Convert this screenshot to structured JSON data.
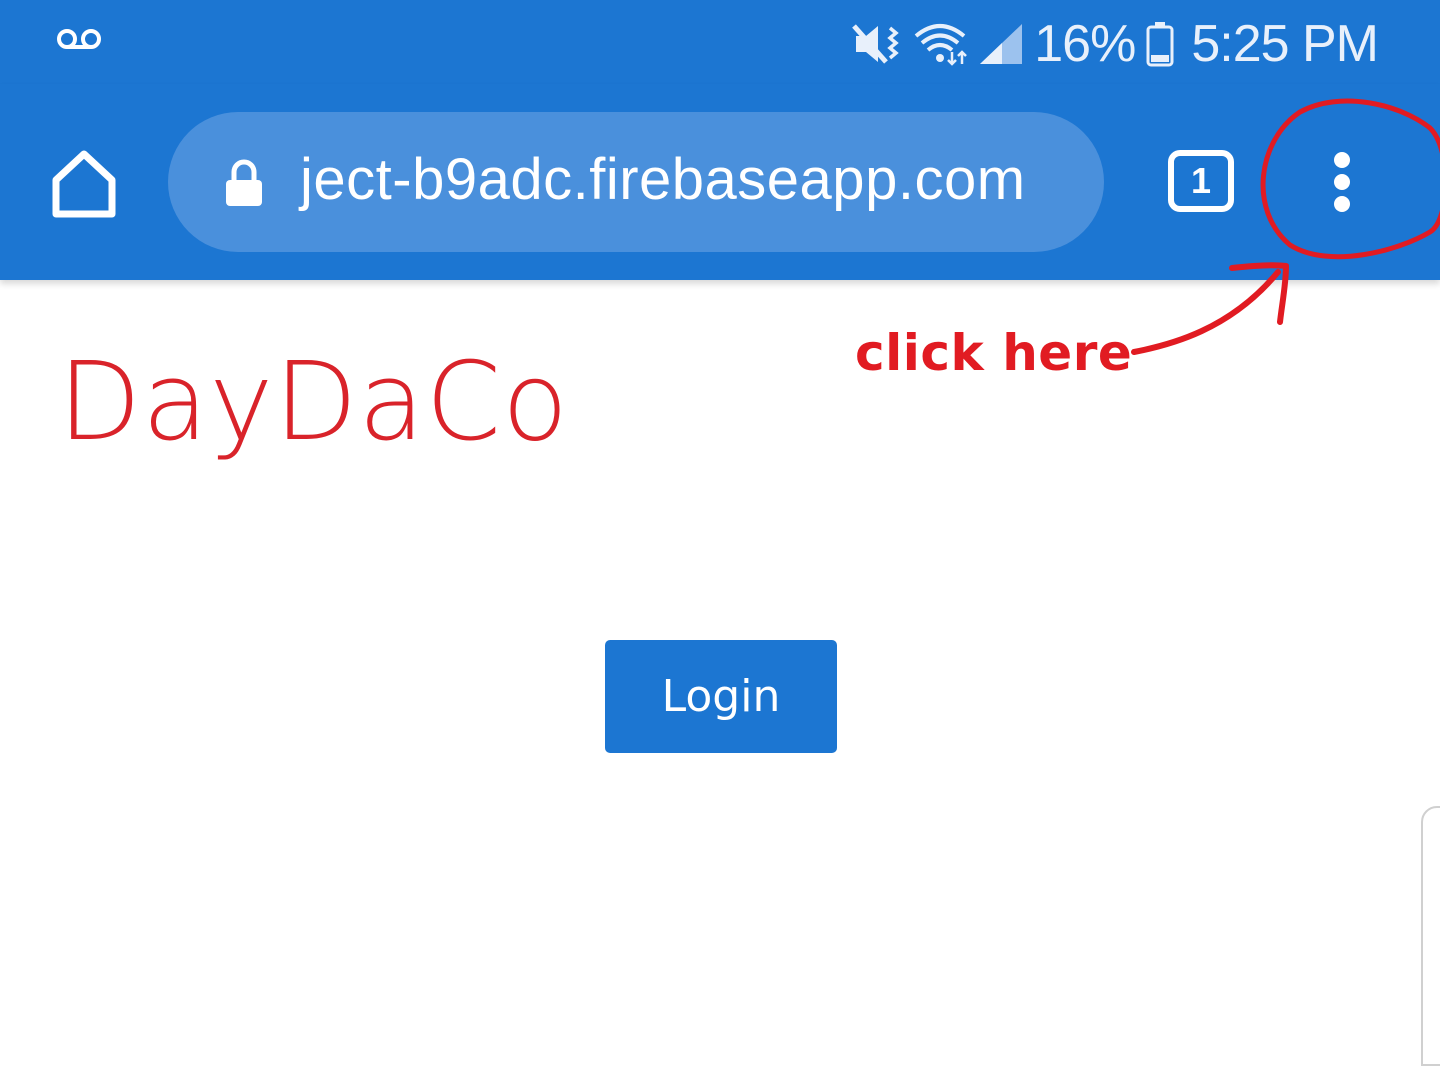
{
  "status_bar": {
    "battery_percent": "16%",
    "time": "5:25 PM",
    "icons": [
      "voicemail-icon",
      "vibrate-icon",
      "wifi-icon",
      "signal-icon",
      "battery-icon"
    ]
  },
  "browser_toolbar": {
    "url": "ject-b9adc.firebaseapp.com",
    "tab_count": "1",
    "icons": [
      "home-icon",
      "lock-icon",
      "tab-switcher-icon",
      "menu-icon"
    ]
  },
  "annotation": {
    "text": "click here",
    "color": "#e11b22"
  },
  "page": {
    "title": "DayDaCo",
    "login_label": "Login"
  },
  "colors": {
    "toolbar": "#1c76d2",
    "omnibox": "#4a90dc",
    "title": "#d9232a",
    "button": "#1c76d2"
  }
}
